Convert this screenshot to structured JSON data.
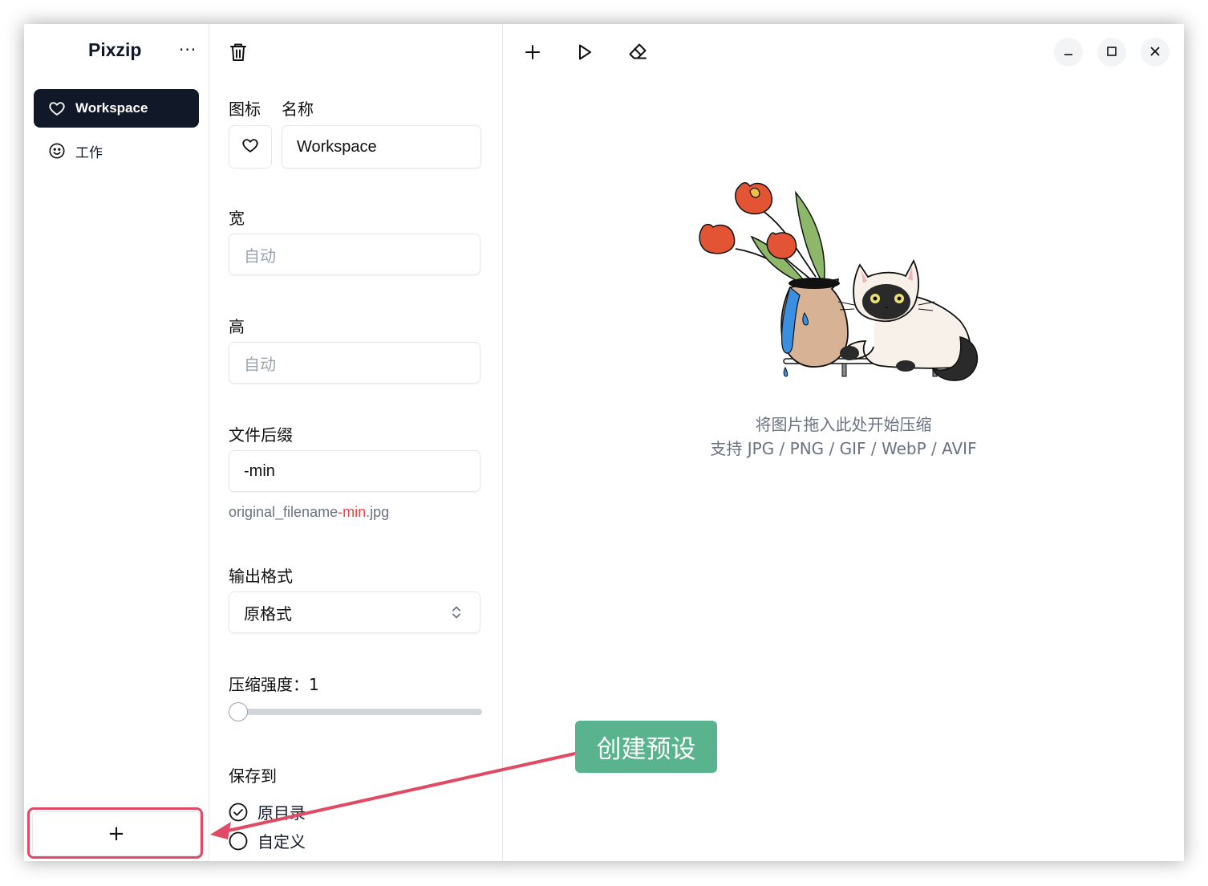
{
  "app": {
    "title": "Pixzip",
    "more_label": "···"
  },
  "sidebar": {
    "items": [
      {
        "label": "Workspace",
        "icon": "heart-icon",
        "active": true
      },
      {
        "label": "工作",
        "icon": "smiley-icon",
        "active": false
      }
    ],
    "add_label": "+"
  },
  "panel": {
    "icon_label": "图标",
    "name_label": "名称",
    "name_value": "Workspace",
    "width_label": "宽",
    "width_placeholder": "自动",
    "height_label": "高",
    "height_placeholder": "自动",
    "suffix_label": "文件后缀",
    "suffix_value": "-min",
    "hint_prefix": "original_filename",
    "hint_highlight": "-min",
    "hint_ext": ".jpg",
    "format_label": "输出格式",
    "format_value": "原格式",
    "strength_label": "压缩强度：1",
    "strength_level": 1,
    "save_label": "保存到",
    "save_options": [
      {
        "label": "原目录",
        "checked": true
      },
      {
        "label": "自定义",
        "checked": false
      }
    ]
  },
  "main": {
    "drop_line1": "将图片拖入此处开始压缩",
    "drop_line2": "支持 JPG / PNG / GIF / WebP / AVIF"
  },
  "annotation": {
    "label": "创建预设"
  },
  "colors": {
    "accent_dark": "#111827",
    "annotation_red": "#e04a64",
    "annotation_green": "#58b38e",
    "suffix_highlight": "#ef4444"
  }
}
